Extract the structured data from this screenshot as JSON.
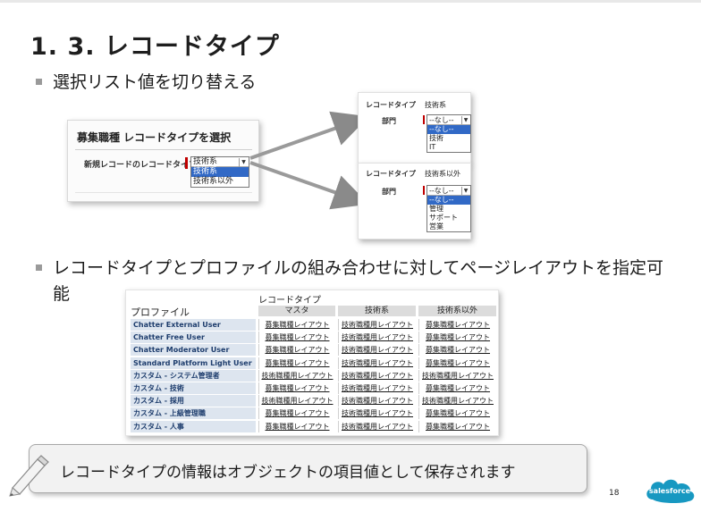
{
  "slide": {
    "title": "1. 3. レコードタイプ",
    "bullet1": "選択リスト値を切り替える",
    "bullet2": "レコードタイプとプロファイルの組み合わせに対してページレイアウトを指定可能",
    "callout": "レコードタイプの情報はオブジェクトの項目値として保存されます",
    "page_number": "18",
    "logo_text": "salesforce",
    "accent_color": "#3169c6",
    "logo_color": "#1798c1"
  },
  "dialog": {
    "title": "募集職種 レコードタイプを選択",
    "field_label": "新規レコードのレコードタイプ",
    "selected": "技術系",
    "options": [
      "技術系",
      "技術系以外"
    ]
  },
  "panel_tech": {
    "type_label": "レコードタイプ",
    "type_value": "技術系",
    "field_label": "部門",
    "selected": "--なし--",
    "options": [
      "--なし--",
      "技術",
      "IT"
    ]
  },
  "panel_nontech": {
    "type_label": "レコードタイプ",
    "type_value": "技術系以外",
    "field_label": "部門",
    "selected": "--なし--",
    "options": [
      "--なし--",
      "管理",
      "サポート",
      "営業"
    ]
  },
  "matrix": {
    "group_header": "レコードタイプ",
    "profile_header": "プロファイル",
    "columns": [
      "マスタ",
      "技術系",
      "技術系以外"
    ],
    "rows": [
      {
        "profile": "Chatter External User",
        "cells": [
          "募集職種レイアウト",
          "技術職種用レイアウト",
          "募集職種レイアウト"
        ]
      },
      {
        "profile": "Chatter Free User",
        "cells": [
          "募集職種レイアウト",
          "技術職種用レイアウト",
          "募集職種レイアウト"
        ]
      },
      {
        "profile": "Chatter Moderator User",
        "cells": [
          "募集職種レイアウト",
          "技術職種用レイアウト",
          "募集職種レイアウト"
        ]
      },
      {
        "profile": "Standard Platform Light User",
        "cells": [
          "募集職種レイアウト",
          "技術職種用レイアウト",
          "募集職種レイアウト"
        ]
      },
      {
        "profile": "カスタム - システム管理者",
        "cells": [
          "技術職種用レイアウト",
          "技術職種用レイアウト",
          "技術職種用レイアウト"
        ]
      },
      {
        "profile": "カスタム - 技術",
        "cells": [
          "募集職種レイアウト",
          "技術職種用レイアウト",
          "募集職種レイアウト"
        ]
      },
      {
        "profile": "カスタム - 採用",
        "cells": [
          "技術職種用レイアウト",
          "技術職種用レイアウト",
          "技術職種用レイアウト"
        ]
      },
      {
        "profile": "カスタム - 上級管理職",
        "cells": [
          "募集職種レイアウト",
          "技術職種用レイアウト",
          "募集職種レイアウト"
        ]
      },
      {
        "profile": "カスタム - 人事",
        "cells": [
          "募集職種レイアウト",
          "技術職種用レイアウト",
          "募集職種レイアウト"
        ]
      }
    ]
  }
}
